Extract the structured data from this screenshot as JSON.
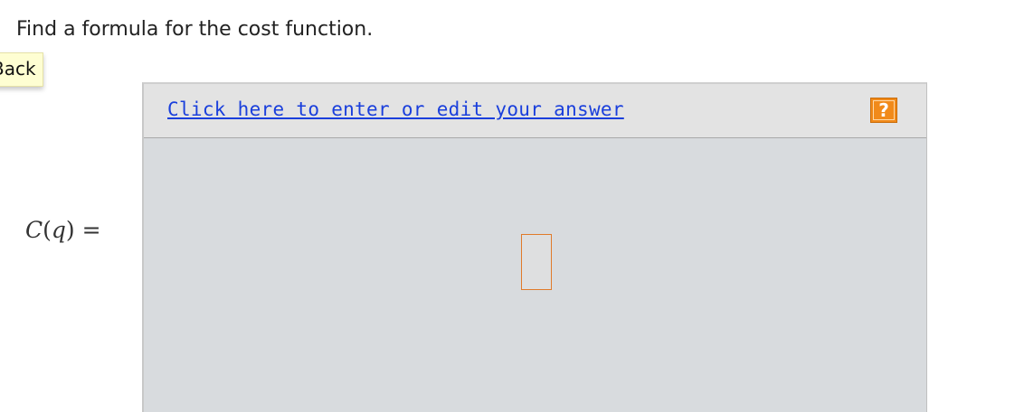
{
  "question": {
    "text": "Find a formula for the cost function."
  },
  "back_tab": {
    "label": "Back"
  },
  "math": {
    "function_name": "C",
    "variable": "q",
    "equals": "="
  },
  "answer_panel": {
    "edit_link_text": "Click here to enter or edit your answer",
    "help_label": "?",
    "help_icon": "help-question-icon",
    "answer_value": ""
  },
  "colors": {
    "link": "#1a3fdc",
    "help_button": "#f18a1a",
    "panel_bg": "#d8dbde",
    "header_bg": "#e3e3e3",
    "answer_box_border": "#e07a2a",
    "back_tab_bg": "#fefed2"
  }
}
